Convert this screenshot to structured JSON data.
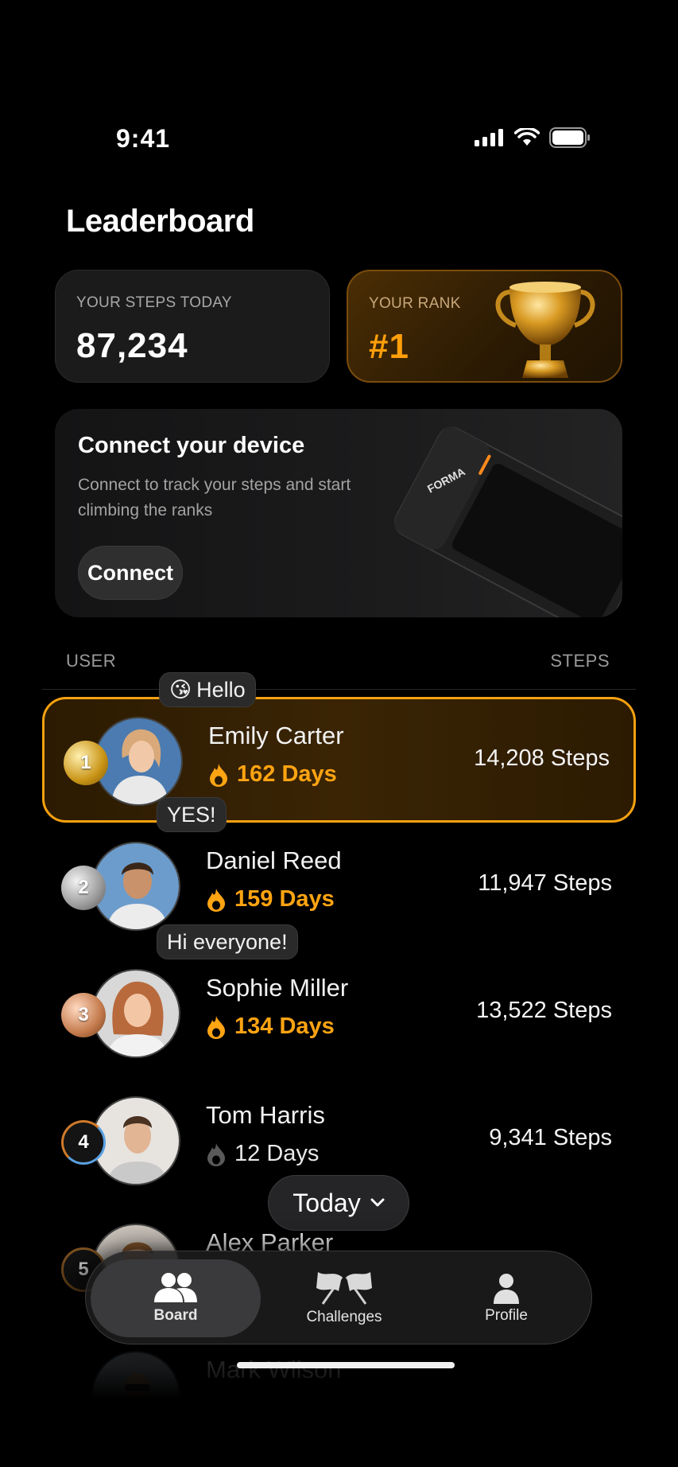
{
  "status": {
    "time": "9:41"
  },
  "title": "Leaderboard",
  "steps_card": {
    "label": "YOUR STEPS TODAY",
    "value": "87,234"
  },
  "rank_card": {
    "label": "YOUR RANK",
    "value": "#1"
  },
  "connect": {
    "title": "Connect your device",
    "description": "Connect to track your steps and start climbing the ranks",
    "button": "Connect",
    "device_brand": "FORMA"
  },
  "columns": {
    "user": "USER",
    "steps": "STEPS"
  },
  "users": [
    {
      "rank": "1",
      "name": "Emily Carter",
      "streak": "162 Days",
      "steps": "14,208 Steps",
      "bubble": "Hello",
      "bubble_emoji": "😘"
    },
    {
      "rank": "2",
      "name": "Daniel Reed",
      "streak": "159 Days",
      "steps": "11,947 Steps",
      "bubble": "YES!"
    },
    {
      "rank": "3",
      "name": "Sophie Miller",
      "streak": "134 Days",
      "steps": "13,522 Steps",
      "bubble": "Hi everyone!"
    },
    {
      "rank": "4",
      "name": "Tom Harris",
      "streak": "12 Days",
      "steps": "9,341 Steps"
    },
    {
      "rank": "5",
      "name": "Alex Parker"
    },
    {
      "name": "Mark Wilson"
    }
  ],
  "filter": {
    "label": "Today"
  },
  "tabs": [
    {
      "label": "Board",
      "icon": "people-icon",
      "active": true
    },
    {
      "label": "Challenges",
      "icon": "flags-icon"
    },
    {
      "label": "Profile",
      "icon": "person-icon"
    }
  ],
  "colors": {
    "accent": "#ff9f0a",
    "background": "#000000"
  }
}
